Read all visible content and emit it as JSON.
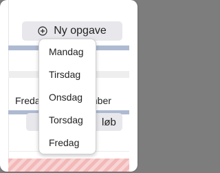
{
  "toolbar": {
    "new_task_label": "Ny opgave",
    "new_task_icon": "circle-plus-icon"
  },
  "background": {
    "row_left_text": "Freda",
    "row_right_text": "mber",
    "button2_label": "løb"
  },
  "dropdown": {
    "items": [
      "Mandag",
      "Tirsdag",
      "Onsdag",
      "Torsdag",
      "Fredag"
    ]
  },
  "colors": {
    "accent_bar": "#aebad1",
    "button_bg": "#e8e8ec",
    "stripe_a": "#f3b8b8",
    "stripe_b": "#f8d4d4"
  }
}
